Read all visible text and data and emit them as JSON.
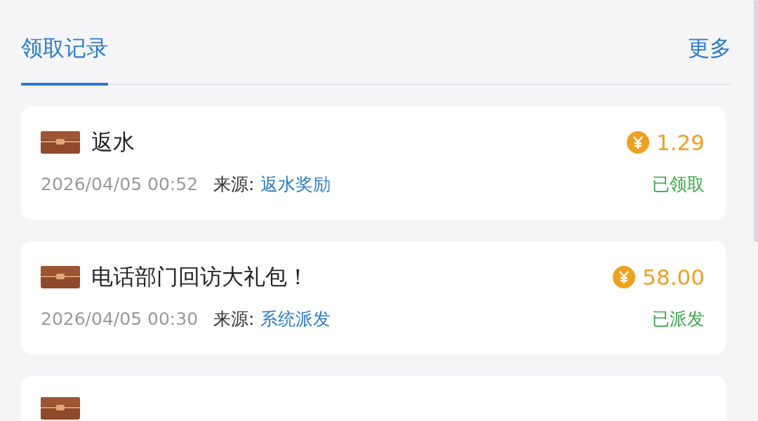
{
  "tabs": [
    {
      "label": "领取记录",
      "selected": true
    }
  ],
  "more_link": "更多",
  "records": [
    {
      "title": "返水",
      "amount": "1.29",
      "time": "2026/04/05 00:52",
      "source_label": "来源:",
      "source": "返水奖励",
      "status": "已领取"
    },
    {
      "title": "电话部门回访大礼包！",
      "amount": "58.00",
      "time": "2026/04/05 00:30",
      "source_label": "来源:",
      "source": "系统派发",
      "status": "已派发"
    }
  ],
  "next_record_peeking": true
}
